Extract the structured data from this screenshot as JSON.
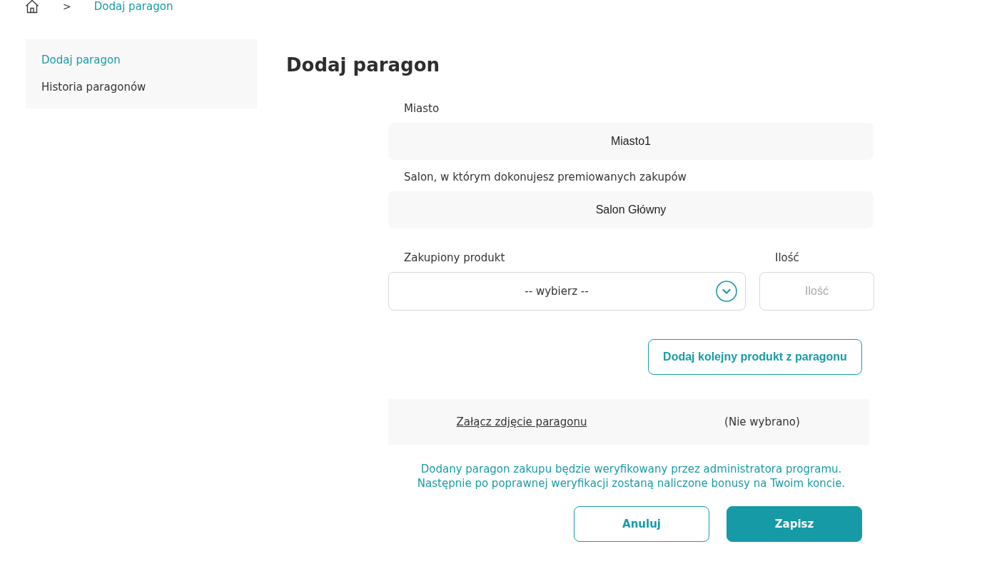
{
  "breadcrumb": {
    "separator": ">",
    "items": [
      {
        "label": "Dodaj paragon"
      }
    ]
  },
  "sidebar": {
    "items": [
      {
        "label": "Dodaj paragon",
        "selected": true
      },
      {
        "label": "Historia paragonów",
        "selected": false
      }
    ]
  },
  "title": "Dodaj paragon",
  "form": {
    "fields": [
      {
        "kind": "readonly",
        "label": "Miasto",
        "value": "Miasto1"
      },
      {
        "kind": "readonly",
        "label": "Salon, w którym dokonujesz premiowanych zakupów",
        "value": "Salon Główny"
      }
    ],
    "product": {
      "label": "Zakupiony produkt",
      "value": "-- wybierz --"
    },
    "quantity": {
      "label": "Ilość",
      "placeholder": "Ilość"
    },
    "add_button": "Dodaj kolejny produkt z paragonu",
    "attachment": {
      "link": "Załącz zdjęcie paragonu",
      "status": "(Nie wybrano)"
    },
    "note": [
      "Dodany paragon zakupu będzie weryfikowany przez administratora programu.",
      "Następnie po poprawnej weryfikacji zostaną naliczone bonusy na Twoim koncie."
    ],
    "buttons": [
      {
        "label": "Anuluj",
        "kind": "secondary"
      },
      {
        "label": "Zapisz",
        "kind": "primary"
      }
    ]
  }
}
